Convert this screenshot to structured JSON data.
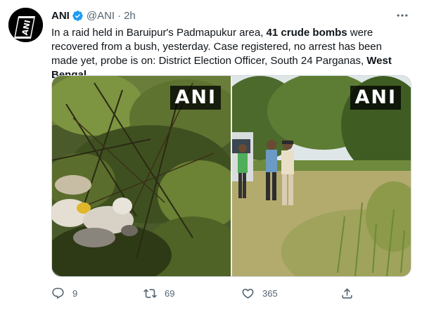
{
  "tweet": {
    "author_name": "ANI",
    "handle": "@ANI",
    "separator": "·",
    "time": "2h",
    "avatar_text": "ANI",
    "text_segments": [
      {
        "text": "In a raid held in Baruipur's Padmapukur area, ",
        "bold": false
      },
      {
        "text": "41 crude bombs",
        "bold": true
      },
      {
        "text": " were recovered from a bush, yesterday. Case registered, no arrest has been made yet, probe is on: District Election Officer, South 24 Parganas, ",
        "bold": false
      },
      {
        "text": "West Bengal",
        "bold": true
      }
    ],
    "media": [
      {
        "watermark": "ANI",
        "icon": "photo-bush-bombs"
      },
      {
        "watermark": "ANI",
        "icon": "photo-officials-field"
      }
    ],
    "actions": {
      "reply_count": "9",
      "retweet_count": "69",
      "like_count": "365"
    }
  },
  "colors": {
    "verified": "#1d9bf0",
    "secondary_text": "#536471",
    "primary_text": "#0f1419"
  },
  "icons": [
    "verified-badge-icon",
    "more-icon",
    "reply-icon",
    "retweet-icon",
    "like-icon",
    "share-icon"
  ]
}
